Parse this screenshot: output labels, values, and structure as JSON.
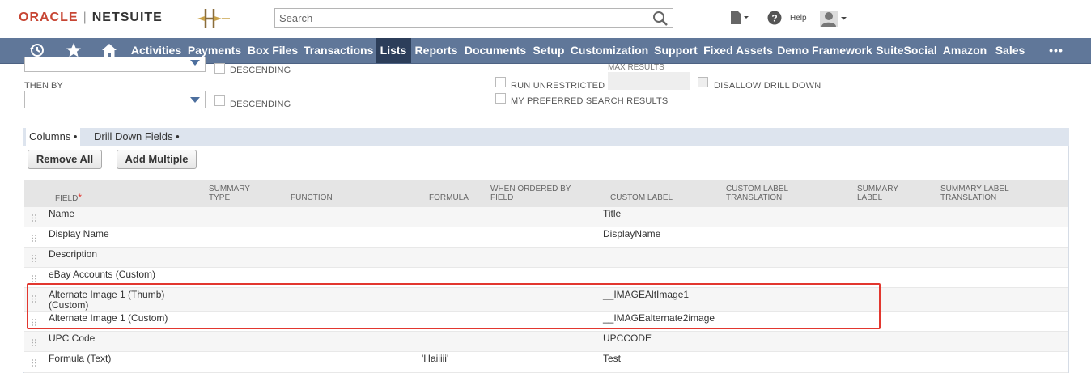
{
  "header": {
    "logo_oracle": "ORACLE",
    "logo_sep": "|",
    "logo_netsuite": "NETSUITE",
    "search_placeholder": "Search",
    "help_label": "Help"
  },
  "nav": {
    "items": [
      "Activities",
      "Payments",
      "Box Files",
      "Transactions",
      "Lists",
      "Reports",
      "Documents",
      "Setup",
      "Customization",
      "Support",
      "Fixed Assets",
      "Demo Framework",
      "SuiteSocial",
      "Amazon",
      "Sales"
    ],
    "active": "Lists",
    "more": "•••",
    "icons": [
      "history-icon",
      "star-icon",
      "home-icon"
    ]
  },
  "sort": {
    "descending_1": "DESCENDING",
    "then_by": "THEN BY",
    "descending_2": "DESCENDING",
    "max_results": "MAX RESULTS",
    "run_unrestricted": "RUN UNRESTRICTED",
    "disallow_drill_down": "DISALLOW DRILL DOWN",
    "my_preferred": "MY PREFERRED SEARCH RESULTS"
  },
  "tabs": {
    "columns": "Columns",
    "drill_down": "Drill Down Fields"
  },
  "buttons": {
    "remove_all": "Remove All",
    "add_multiple": "Add Multiple"
  },
  "table": {
    "headers": {
      "field": "FIELD",
      "summary_type": "SUMMARY\nTYPE",
      "function": "FUNCTION",
      "formula": "FORMULA",
      "when_ordered": "WHEN ORDERED BY\nFIELD",
      "custom_label": "CUSTOM LABEL",
      "custom_label_translation": "CUSTOM LABEL\nTRANSLATION",
      "summary_label": "SUMMARY\nLABEL",
      "summary_label_translation": "SUMMARY LABEL\nTRANSLATION"
    },
    "rows": [
      {
        "field": "Name",
        "formula": "",
        "custom_label": "Title"
      },
      {
        "field": "Display Name",
        "formula": "",
        "custom_label": "DisplayName"
      },
      {
        "field": "Description",
        "formula": "",
        "custom_label": ""
      },
      {
        "field": "eBay Accounts (Custom)",
        "formula": "",
        "custom_label": ""
      },
      {
        "field": "Alternate Image 1 (Thumb)\n(Custom)",
        "formula": "",
        "custom_label": "__IMAGEAltImage1"
      },
      {
        "field": "Alternate Image 1 (Custom)",
        "formula": "",
        "custom_label": "__IMAGEalternate2image"
      },
      {
        "field": "UPC Code",
        "formula": "",
        "custom_label": "UPCCODE"
      },
      {
        "field": "Formula (Text)",
        "formula": "'Haiiiii'",
        "custom_label": "Test"
      }
    ]
  },
  "colors": {
    "nav_bg": "#607799",
    "nav_active": "#2c3e5a",
    "highlight": "#e2372f",
    "oracle_red": "#c74634"
  }
}
